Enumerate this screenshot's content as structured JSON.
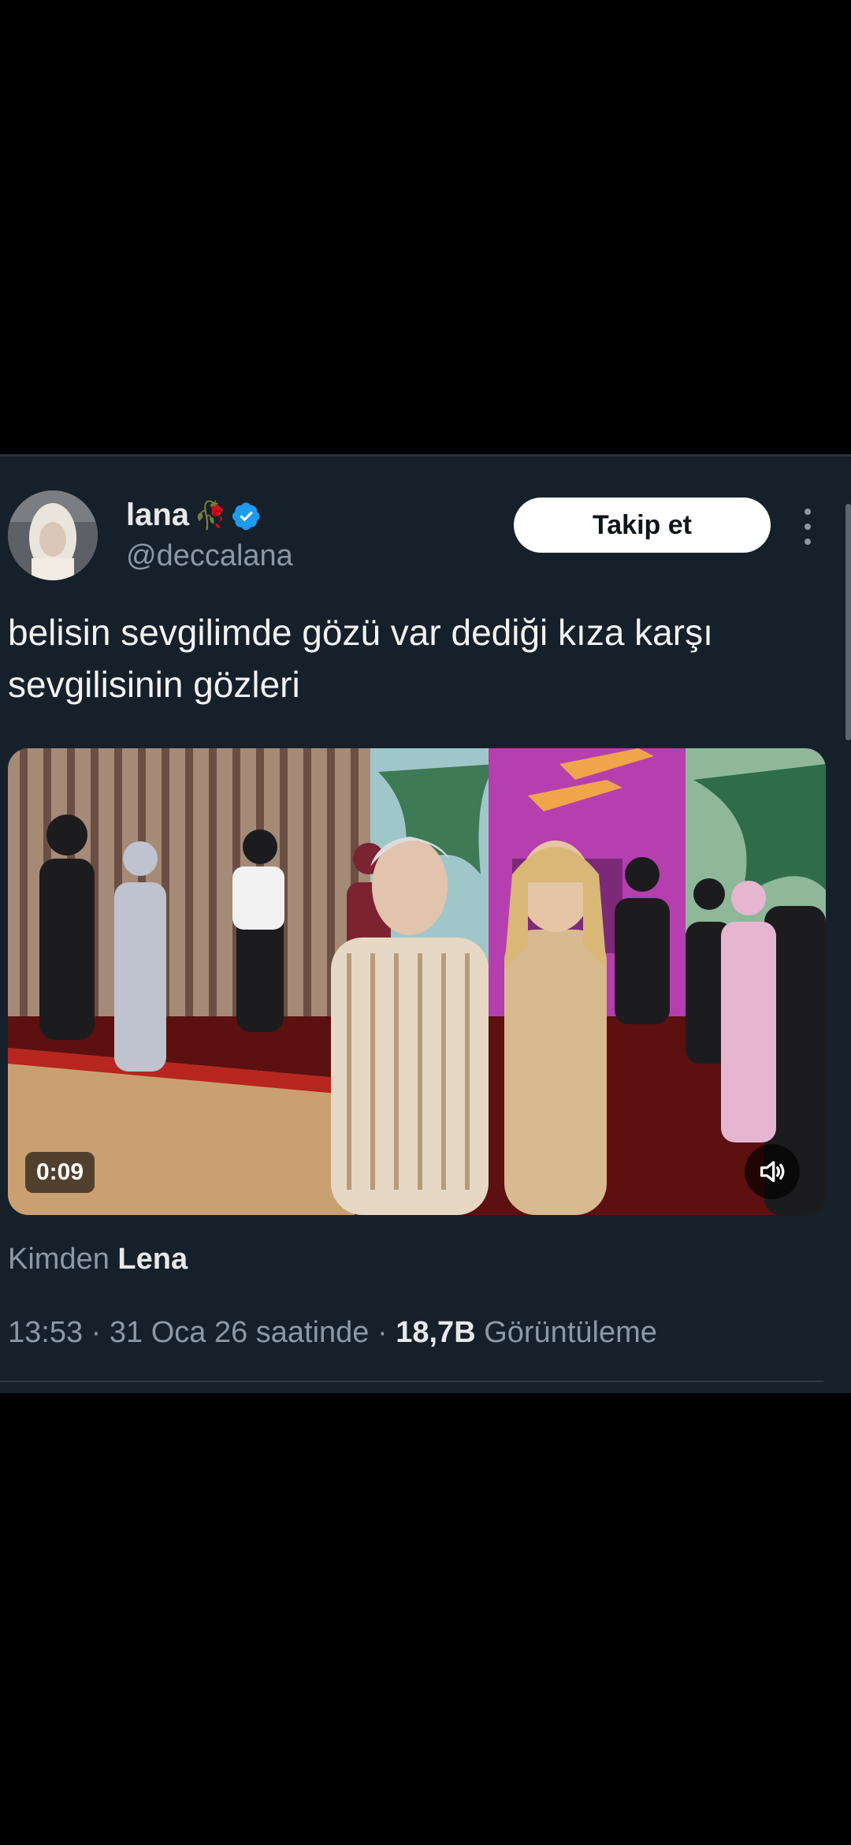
{
  "author": {
    "name": "lana",
    "name_emoji": "🥀",
    "handle": "@deccalana",
    "verified": true
  },
  "follow_button": {
    "label": "Takip et"
  },
  "tweet": {
    "text": "belisin sevgilimde gözü var dediği kıza karşı sevgilisinin gözleri"
  },
  "video": {
    "duration": "0:09",
    "muted": true
  },
  "attribution": {
    "prefix": "Kimden",
    "source": "Lena"
  },
  "meta": {
    "time": "13:53",
    "sep1": "·",
    "date": "31 Oca 26 saatinde",
    "sep2": "·",
    "views": "18,7B",
    "views_label": "Görüntüleme"
  },
  "colors": {
    "background": "#000000",
    "card": "#15202b",
    "muted_text": "#8b98a5",
    "verified": "#1d9bf0"
  },
  "icons": [
    "verified-badge-icon",
    "more-options-icon",
    "volume-icon"
  ]
}
